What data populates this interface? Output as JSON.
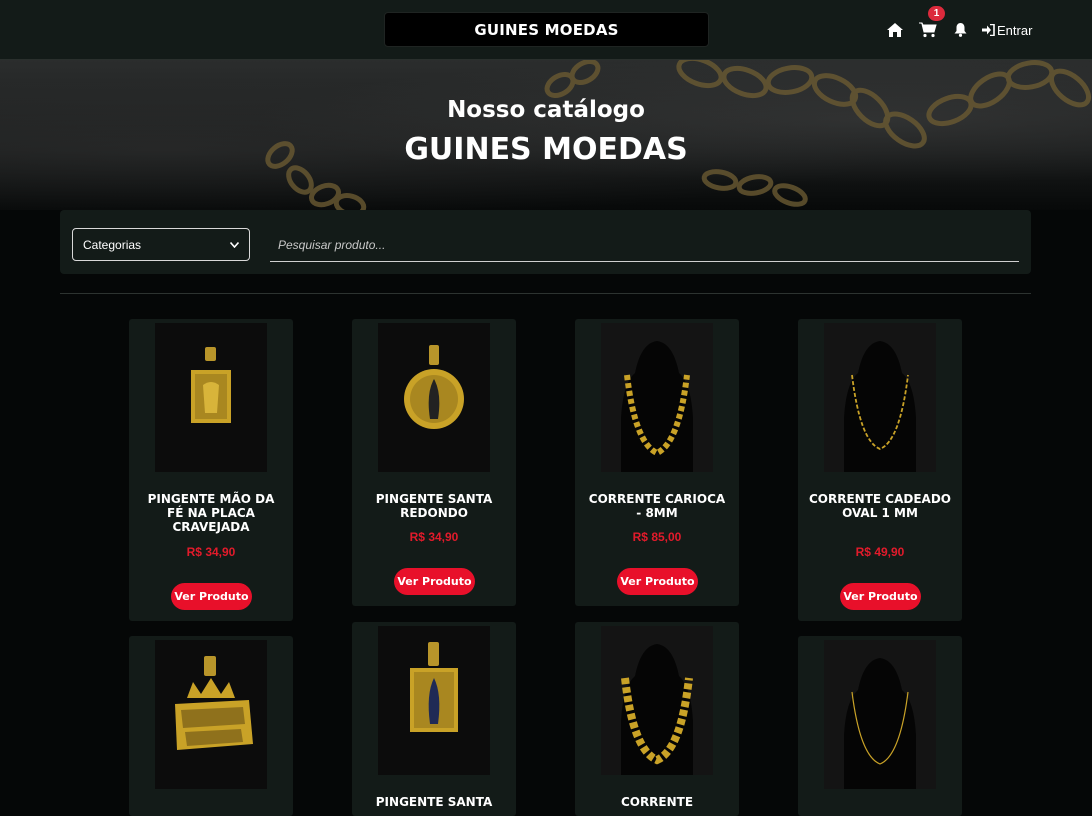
{
  "header": {
    "brand": "GUINES MOEDAS",
    "cart_count": "1",
    "login_label": "Entrar"
  },
  "hero": {
    "subtitle": "Nosso catálogo",
    "title": "GUINES MOEDAS"
  },
  "filter": {
    "category_selected": "Categorias",
    "search_placeholder": "Pesquisar produto..."
  },
  "products": [
    {
      "name": "PINGENTE MÃO DA FÉ NA PLACA CRAVEJADA",
      "price": "R$ 34,90",
      "button": "Ver Produto",
      "image": "pendant-hands-image"
    },
    {
      "name": "PINGENTE SANTA REDONDO",
      "price": "R$ 34,90",
      "button": "Ver Produto",
      "image": "pendant-round-saint-image"
    },
    {
      "name": "CORRENTE CARIOCA - 8MM",
      "price": "R$ 85,00",
      "button": "Ver Produto",
      "image": "chain-carioca-image"
    },
    {
      "name": "CORRENTE CADEADO OVAL 1 MM",
      "price": "R$ 49,90",
      "button": "Ver Produto",
      "image": "chain-oval-image"
    },
    {
      "name": "",
      "price": "",
      "button": "",
      "image": "pendant-favela-venceu-image"
    },
    {
      "name": "PINGENTE SANTA",
      "price": "",
      "button": "",
      "image": "pendant-saint-plate-image"
    },
    {
      "name": "CORRENTE",
      "price": "",
      "button": "",
      "image": "chain-thick-image"
    },
    {
      "name": "",
      "price": "",
      "button": "",
      "image": "chain-thin-image"
    }
  ],
  "colors": {
    "header_bg": "#131b18",
    "page_bg": "#050707",
    "accent_red": "#e8102a",
    "price_red": "#e21b2b",
    "gold": "#c9a227"
  }
}
